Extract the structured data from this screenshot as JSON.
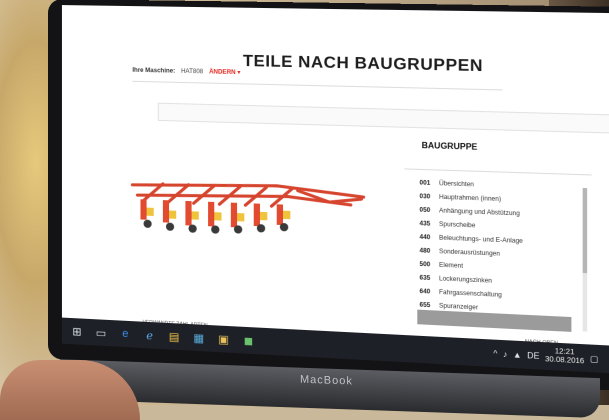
{
  "page": {
    "title": "TEILE NACH BAUGRUPPEN"
  },
  "machine": {
    "label": "Ihre Maschine:",
    "value": "HAT808",
    "change": "ÄNDERN"
  },
  "groups": {
    "title": "BAUGRUPPE",
    "items": [
      {
        "code": "001",
        "name": "Übersichten"
      },
      {
        "code": "030",
        "name": "Hauptrahmen (innen)"
      },
      {
        "code": "050",
        "name": "Anhängung und Abstützung"
      },
      {
        "code": "435",
        "name": "Spurscheibe"
      },
      {
        "code": "440",
        "name": "Beleuchtungs- und E-Anlage"
      },
      {
        "code": "480",
        "name": "Sonderausrüstungen"
      },
      {
        "code": "500",
        "name": "Element"
      },
      {
        "code": "635",
        "name": "Lockerungszinken"
      },
      {
        "code": "640",
        "name": "Fahrgassenschaltung"
      },
      {
        "code": "655",
        "name": "Spuranzeiger"
      }
    ]
  },
  "footer": {
    "left_link": "VERWANDTE ZAHL ARTEN",
    "top_link": "NACH OBEN"
  },
  "taskbar": {
    "icons": [
      "windows-icon",
      "task-view-icon",
      "edge-icon",
      "ie-icon",
      "explorer-icon",
      "store-icon",
      "folder-icon",
      "app-icon"
    ],
    "time": "12:21",
    "date": "30.08.2016",
    "tray_lang": "DE"
  },
  "device": {
    "brand": "MacBook"
  },
  "colors": {
    "accent": "#e3261f",
    "taskbar": "#1d2026"
  }
}
